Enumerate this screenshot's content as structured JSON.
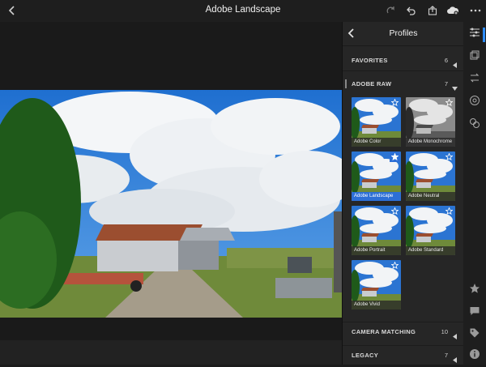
{
  "app": {
    "title": "Adobe Landscape"
  },
  "panel": {
    "title": "Profiles",
    "sections": [
      {
        "label": "FAVORITES",
        "count": "6",
        "expanded": false
      },
      {
        "label": "ADOBE RAW",
        "count": "7",
        "expanded": true
      },
      {
        "label": "CAMERA MATCHING",
        "count": "10",
        "expanded": false
      },
      {
        "label": "LEGACY",
        "count": "7",
        "expanded": false
      }
    ],
    "profiles": [
      {
        "name": "Adobe Color",
        "selected": false,
        "mono": false
      },
      {
        "name": "Adobe Monochrome",
        "selected": false,
        "mono": true
      },
      {
        "name": "Adobe Landscape",
        "selected": true,
        "mono": false
      },
      {
        "name": "Adobe Neutral",
        "selected": false,
        "mono": false
      },
      {
        "name": "Adobe Portrait",
        "selected": false,
        "mono": false
      },
      {
        "name": "Adobe Standard",
        "selected": false,
        "mono": false
      },
      {
        "name": "Adobe Vivid",
        "selected": false,
        "mono": false
      }
    ]
  },
  "icons": {
    "topbar": [
      "back-chevron-icon",
      "redo-icon",
      "undo-icon",
      "share-icon",
      "cloud-sync-icon",
      "more-icon"
    ],
    "rail": [
      "edit-sliders-icon",
      "profiles-icon",
      "compare-icon",
      "healing-icon",
      "presets-icon",
      "star-icon",
      "comment-icon",
      "tag-icon",
      "info-icon"
    ]
  },
  "colors": {
    "accent": "#2d6fd6",
    "panel_bg": "#262626",
    "rail_bg": "#1e1e1e"
  }
}
